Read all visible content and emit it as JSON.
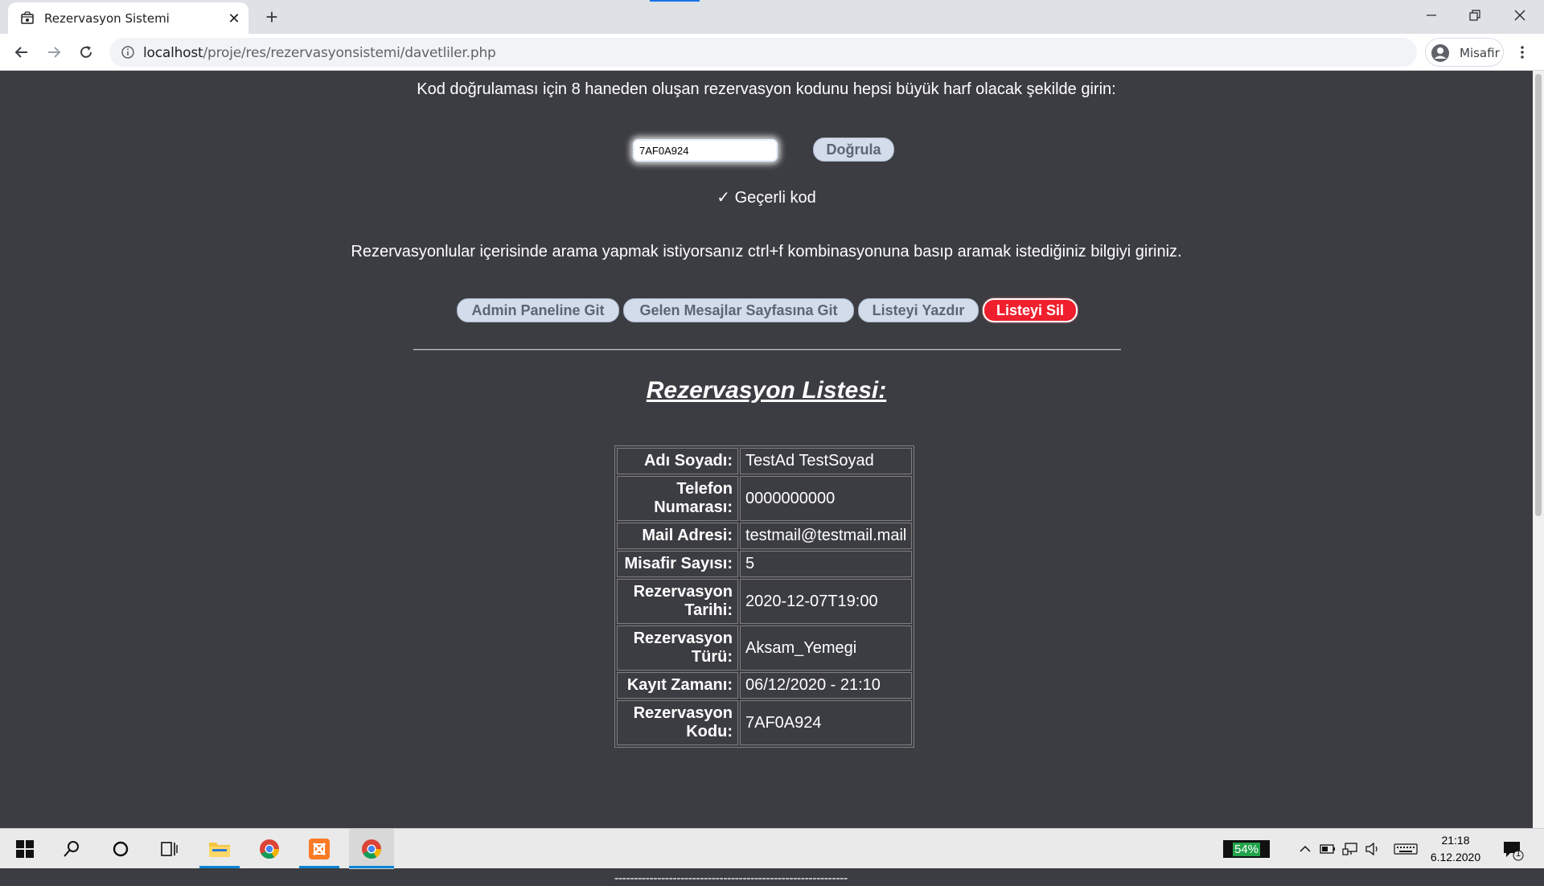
{
  "browser": {
    "tab_title": "Rezervasyon Sistemi",
    "url_host": "localhost",
    "url_path": "/proje/res/rezervasyonsistemi/davetliler.php",
    "profile_label": "Misafir"
  },
  "page": {
    "code_instruction": "Kod doğrulaması için 8 haneden oluşan rezervasyon kodunu hepsi büyük harf olacak şekilde girin:",
    "code_input_value": "7AF0A924",
    "verify_button": "Doğrula",
    "valid_message": "✓ Geçerli kod",
    "search_hint": "Rezervasyonlular içerisinde arama yapmak istiyorsanız ctrl+f kombinasyonuna basıp aramak istediğiniz bilgiyi giriniz.",
    "buttons": {
      "admin": "Admin Paneline Git",
      "messages": "Gelen Mesajlar Sayfasına Git",
      "print": "Listeyi Yazdır",
      "delete": "Listeyi Sil"
    },
    "list_title": "Rezervasyon Listesi:",
    "rows": [
      {
        "label": "Adı Soyadı:",
        "value": "TestAd TestSoyad"
      },
      {
        "label": "Telefon Numarası:",
        "value": "0000000000"
      },
      {
        "label": "Mail Adresi:",
        "value": "testmail@testmail.mail"
      },
      {
        "label": "Misafir Sayısı:",
        "value": "5"
      },
      {
        "label": "Rezervasyon Tarihi:",
        "value": "2020-12-07T19:00"
      },
      {
        "label": "Rezervasyon Türü:",
        "value": "Aksam_Yemegi"
      },
      {
        "label": "Kayıt Zamanı:",
        "value": "06/12/2020 - 21:10"
      },
      {
        "label": "Rezervasyon Kodu:",
        "value": "7AF0A924"
      }
    ],
    "separator": "------------------------------------------------------------"
  },
  "taskbar": {
    "battery_percent": "54%",
    "time": "21:18",
    "date": "6.12.2020",
    "notification_count": "1"
  },
  "colors": {
    "page_bg": "#3c3d42",
    "delete_button": "#f01f2e",
    "action_button": "#d3dcea"
  }
}
